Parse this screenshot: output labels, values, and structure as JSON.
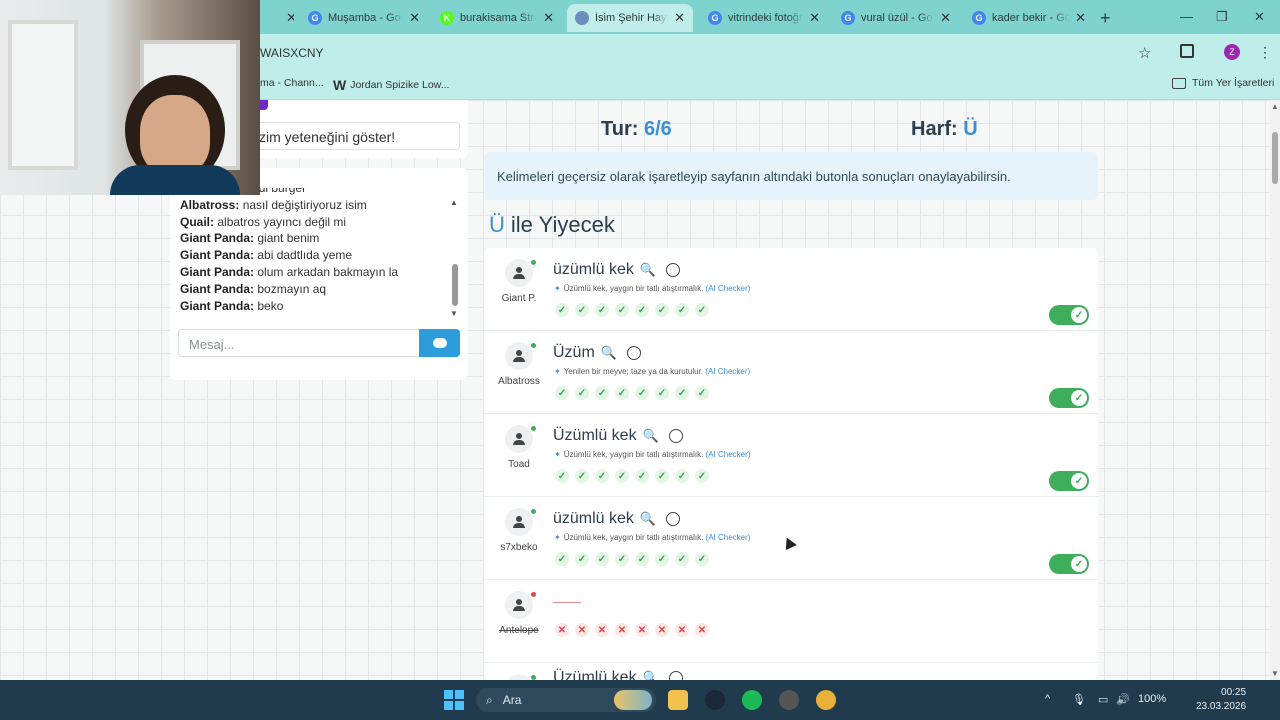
{
  "browser": {
    "tabs": [
      {
        "title": "Muşamba - Goo",
        "icon": "google-icon",
        "color": "#4285f4",
        "letter": "G",
        "active": false
      },
      {
        "title": "burakisama Stre",
        "icon": "kick-icon",
        "color": "#53fc18",
        "letter": "K",
        "active": false
      },
      {
        "title": "İsim Şehir Hayva",
        "icon": "site-icon",
        "color": "#6c8ebf",
        "letter": "",
        "active": true
      },
      {
        "title": "vitrindeki fotoğr",
        "icon": "google-icon",
        "color": "#4285f4",
        "letter": "G",
        "active": false
      },
      {
        "title": "vural üzül - Goo",
        "icon": "google-icon",
        "color": "#4285f4",
        "letter": "G",
        "active": false
      },
      {
        "title": "kader bekir - Go",
        "icon": "google-icon",
        "color": "#4285f4",
        "letter": "G",
        "active": false
      }
    ],
    "url": "WAISXCNY",
    "profile_letter": "Z",
    "bookmarks": [
      {
        "label": "ma - Chann..."
      },
      {
        "label": "Jordan Spizike Low..."
      }
    ],
    "all_bookmarks": "Tüm Yer İşaretleri"
  },
  "left": {
    "talent_input": "zim yeteneğini göster!",
    "chat": {
      "messages": [
        {
          "user": "Albatross:",
          "text": "geldi burger"
        },
        {
          "user": "Albatross:",
          "text": "nasıl değiştiriyoruz isim"
        },
        {
          "user": "Quail:",
          "text": "albatros yayıncı değil mi"
        },
        {
          "user": "Giant Panda:",
          "text": "giant benim"
        },
        {
          "user": "Giant Panda:",
          "text": "abi dadtlıda yeme"
        },
        {
          "user": "Giant Panda:",
          "text": "olum arkadan bakmayın la"
        },
        {
          "user": "Giant Panda:",
          "text": "bozmayın aq"
        },
        {
          "user": "Giant Panda:",
          "text": "beko"
        }
      ],
      "placeholder": "Mesaj..."
    }
  },
  "game": {
    "tur_label": "Tur:",
    "tur_value": "6/6",
    "harf_label": "Harf:",
    "harf_value": "Ü",
    "info": "Kelimeleri geçersiz olarak işaretleyip sayfanın altındaki butonla sonuçları onaylayabilirsin.",
    "category_letter": "Ü",
    "category_title": "ile Yiyecek",
    "ai_label": "(AI Checker)",
    "answers": [
      {
        "player": "Giant P.",
        "word": "üzümlü kek",
        "ai": "Üzümlü kek, yaygın bir tatlı atıştırmalık.",
        "votes": "ok",
        "vote_count": 8,
        "online": true,
        "valid": true
      },
      {
        "player": "Albatross",
        "word": "Üzüm",
        "ai": "Yenilen bir meyve; taze ya da kurutulur.",
        "votes": "ok",
        "vote_count": 8,
        "online": true,
        "valid": true
      },
      {
        "player": "Toad",
        "word": "Üzümlü kek",
        "ai": "Üzümlü kek, yaygın bir tatlı atıştırmalık.",
        "votes": "ok",
        "vote_count": 8,
        "online": true,
        "valid": true
      },
      {
        "player": "s7xbeko",
        "word": "üzümlü kek",
        "ai": "Üzümlü kek, yaygın bir tatlı atıştırmalık.",
        "votes": "ok",
        "vote_count": 8,
        "online": true,
        "valid": true
      },
      {
        "player": "Antelope",
        "word": "",
        "ai": "",
        "votes": "no",
        "vote_count": 8,
        "online": false,
        "valid": false
      },
      {
        "player": "",
        "word": "Üzümlü kek",
        "ai": "",
        "votes": "ok",
        "vote_count": 0,
        "online": true,
        "valid": true
      }
    ]
  },
  "taskbar": {
    "search_label": "Ara",
    "battery": "100%",
    "time": "00:25",
    "date": "23.03.2026"
  }
}
